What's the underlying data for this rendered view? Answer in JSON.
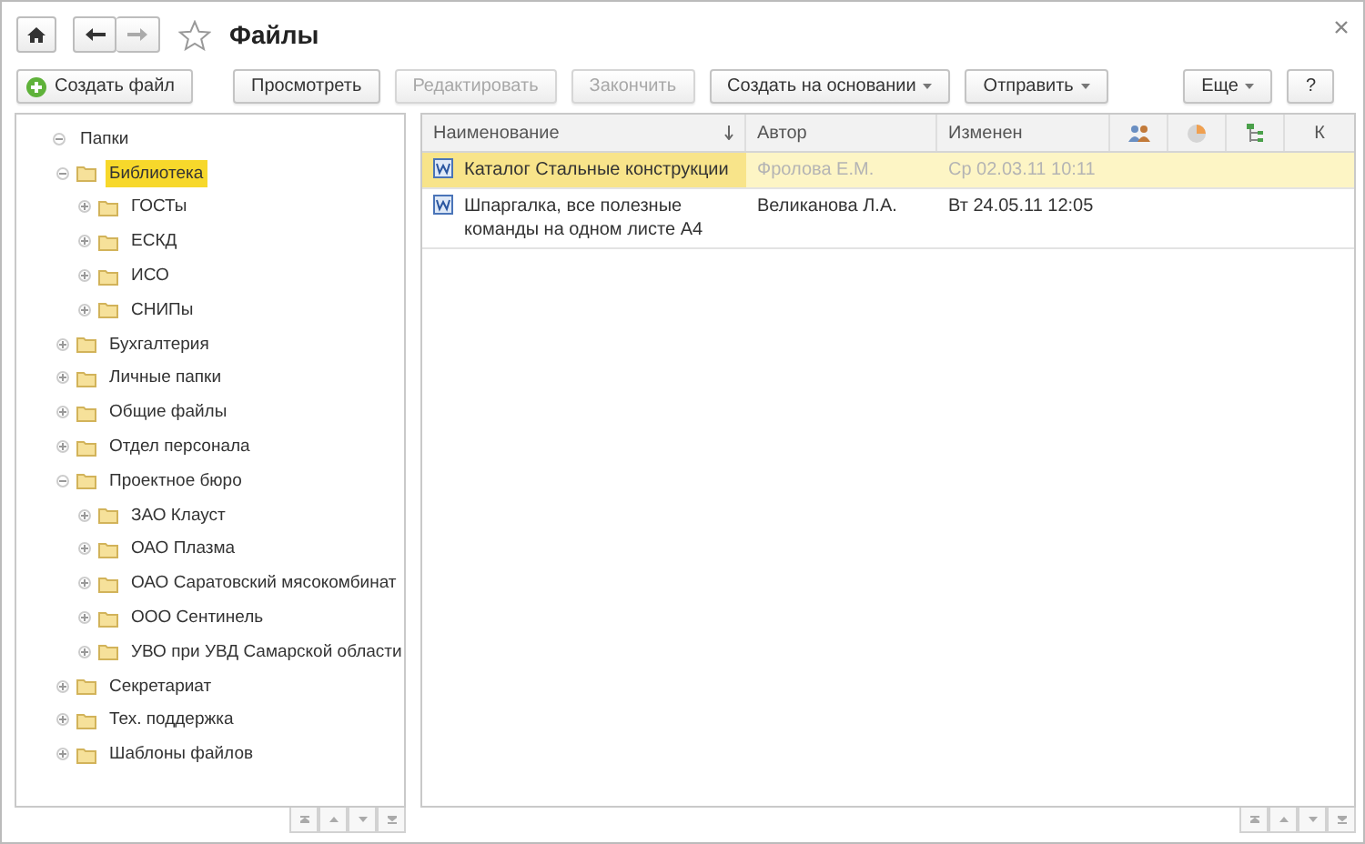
{
  "window": {
    "title": "Файлы",
    "favorite": false
  },
  "toolbar": {
    "left": [
      {
        "label": "Создать файл",
        "kind": "create",
        "disabled": false,
        "dropdown": false
      },
      {
        "label": "Просмотреть",
        "kind": "plain",
        "disabled": false,
        "dropdown": false
      },
      {
        "label": "Редактировать",
        "kind": "plain",
        "disabled": true,
        "dropdown": false
      },
      {
        "label": "Закончить",
        "kind": "plain",
        "disabled": true,
        "dropdown": false
      },
      {
        "label": "Создать на основании",
        "kind": "plain",
        "disabled": false,
        "dropdown": true
      },
      {
        "label": "Отправить",
        "kind": "plain",
        "disabled": false,
        "dropdown": true
      }
    ],
    "right": [
      {
        "label": "Еще",
        "kind": "plain",
        "disabled": false,
        "dropdown": true
      },
      {
        "label": "?",
        "kind": "plain",
        "disabled": false,
        "dropdown": false
      }
    ]
  },
  "tree": {
    "label": "Папки",
    "expanded": true,
    "selected": false,
    "children": [
      {
        "label": "Библиотека",
        "expanded": true,
        "selected": true,
        "children": [
          {
            "label": "ГОСТы",
            "expanded": false,
            "selected": false
          },
          {
            "label": "ЕСКД",
            "expanded": false,
            "selected": false
          },
          {
            "label": "ИСО",
            "expanded": false,
            "selected": false
          },
          {
            "label": "СНИПы",
            "expanded": false,
            "selected": false
          }
        ]
      },
      {
        "label": "Бухгалтерия",
        "expanded": false,
        "selected": false
      },
      {
        "label": "Личные папки",
        "expanded": false,
        "selected": false
      },
      {
        "label": "Общие файлы",
        "expanded": false,
        "selected": false
      },
      {
        "label": "Отдел персонала",
        "expanded": false,
        "selected": false
      },
      {
        "label": "Проектное бюро",
        "expanded": true,
        "selected": false,
        "children": [
          {
            "label": "ЗАО Клауст",
            "expanded": false,
            "selected": false
          },
          {
            "label": "ОАО Плазма",
            "expanded": false,
            "selected": false
          },
          {
            "label": "ОАО Саратовский мясокомбинат",
            "expanded": false,
            "selected": false
          },
          {
            "label": "ООО Сентинель",
            "expanded": false,
            "selected": false
          },
          {
            "label": "УВО при УВД Самарской области",
            "expanded": false,
            "selected": false
          }
        ]
      },
      {
        "label": "Секретариат",
        "expanded": false,
        "selected": false
      },
      {
        "label": "Тех. поддержка",
        "expanded": false,
        "selected": false
      },
      {
        "label": "Шаблоны файлов",
        "expanded": false,
        "selected": false
      }
    ]
  },
  "table": {
    "columns": [
      {
        "kind": "text",
        "label": "Наименование",
        "sorted": true
      },
      {
        "kind": "text",
        "label": "Автор",
        "sorted": false
      },
      {
        "kind": "text",
        "label": "Изменен",
        "sorted": false
      },
      {
        "kind": "people",
        "sorted": false
      },
      {
        "kind": "pie",
        "sorted": false
      },
      {
        "kind": "tree",
        "sorted": false
      },
      {
        "kind": "text",
        "label": "К",
        "sorted": false
      }
    ],
    "rows": [
      {
        "name": "Каталог Стальные конструкции",
        "author": "Фролова Е.М.",
        "modified": "Ср 02.03.11 10:11",
        "selected": true
      },
      {
        "name": "Шпаргалка, все полезные команды на одном листе А4",
        "author": "Великанова Л.А.",
        "modified": "Вт 24.05.11 12:05",
        "selected": false
      }
    ]
  }
}
